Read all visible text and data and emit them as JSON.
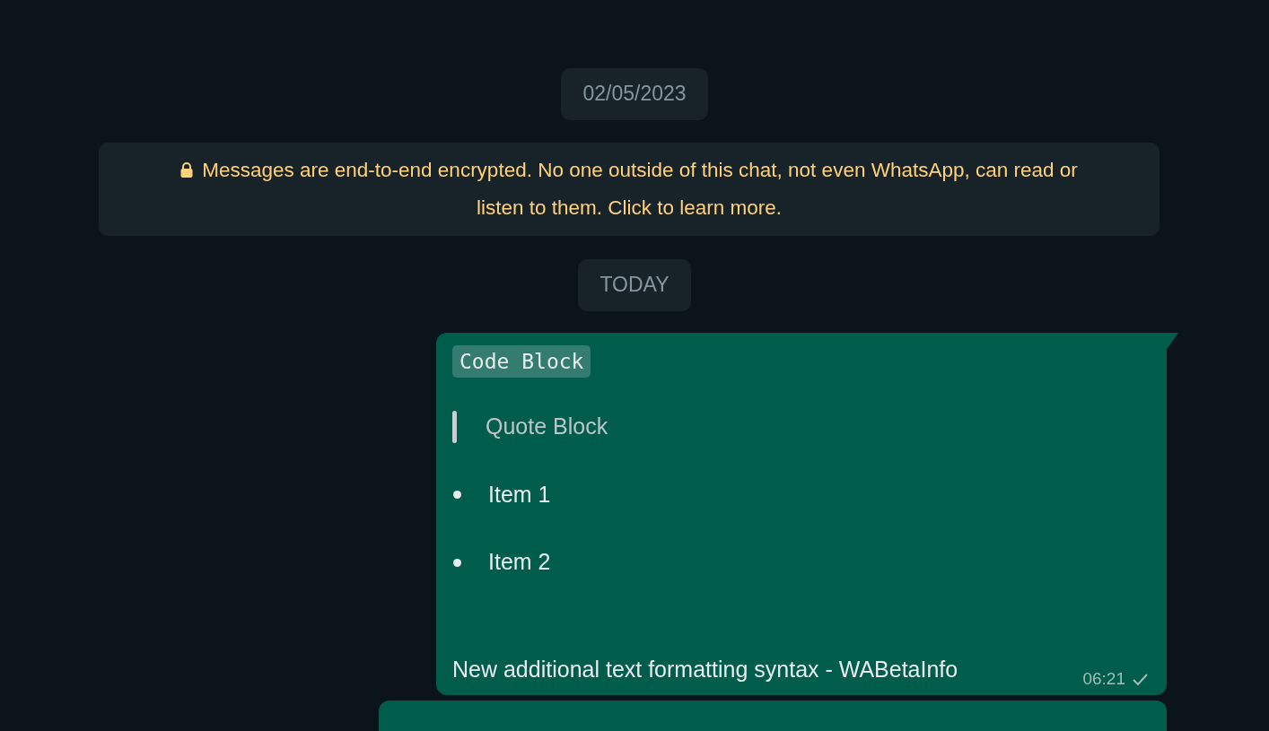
{
  "date_chip": "02/05/2023",
  "encryption_notice": "Messages are end-to-end encrypted. No one outside of this chat, not even WhatsApp, can read or listen to them. Click to learn more.",
  "today_chip": "TODAY",
  "messages": [
    {
      "kind": "formatted",
      "code": "Code Block",
      "quote": "Quote Block",
      "list_items": [
        "Item 1",
        "Item 2"
      ],
      "text": "New additional text formatting syntax - WABetaInfo",
      "time": "06:21",
      "delivered": false
    },
    {
      "kind": "cut_off"
    }
  ]
}
